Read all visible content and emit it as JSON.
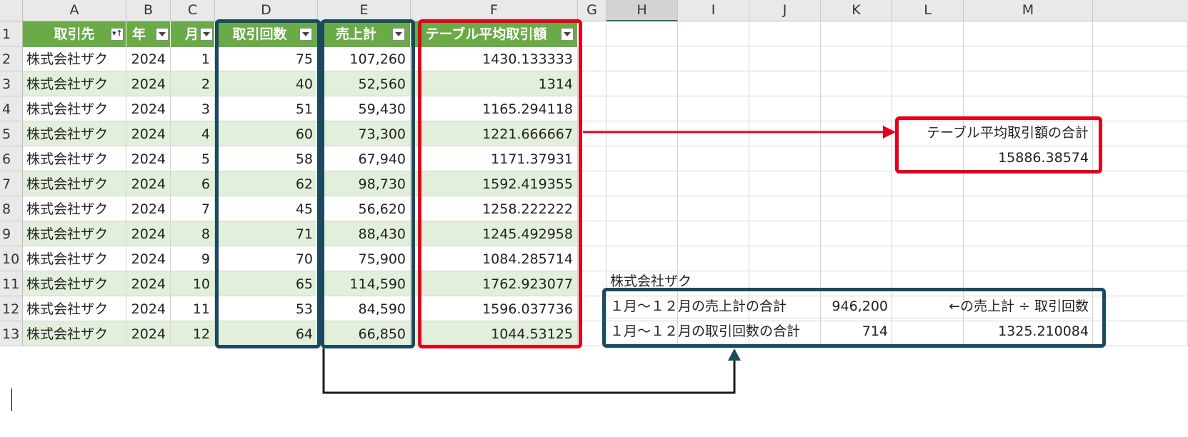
{
  "column_letters": [
    "A",
    "B",
    "C",
    "D",
    "E",
    "F",
    "G",
    "H",
    "I",
    "J",
    "K",
    "L",
    "M"
  ],
  "row_numbers": [
    "1",
    "2",
    "3",
    "4",
    "5",
    "6",
    "7",
    "8",
    "9",
    "10",
    "11",
    "12",
    "13"
  ],
  "table": {
    "headers": [
      "取引先",
      "年",
      "月",
      "取引回数",
      "売上計",
      "テーブル平均取引額"
    ],
    "rows": [
      [
        "株式会社ザク",
        "2024",
        "1",
        "75",
        "107,260",
        "1430.133333"
      ],
      [
        "株式会社ザク",
        "2024",
        "2",
        "40",
        "52,560",
        "1314"
      ],
      [
        "株式会社ザク",
        "2024",
        "3",
        "51",
        "59,430",
        "1165.294118"
      ],
      [
        "株式会社ザク",
        "2024",
        "4",
        "60",
        "73,300",
        "1221.666667"
      ],
      [
        "株式会社ザク",
        "2024",
        "5",
        "58",
        "67,940",
        "1171.37931"
      ],
      [
        "株式会社ザク",
        "2024",
        "6",
        "62",
        "98,730",
        "1592.419355"
      ],
      [
        "株式会社ザク",
        "2024",
        "7",
        "45",
        "56,620",
        "1258.222222"
      ],
      [
        "株式会社ザク",
        "2024",
        "8",
        "71",
        "88,430",
        "1245.492958"
      ],
      [
        "株式会社ザク",
        "2024",
        "9",
        "70",
        "75,900",
        "1084.285714"
      ],
      [
        "株式会社ザク",
        "2024",
        "10",
        "65",
        "114,590",
        "1762.923077"
      ],
      [
        "株式会社ザク",
        "2024",
        "11",
        "53",
        "84,590",
        "1596.037736"
      ],
      [
        "株式会社ザク",
        "2024",
        "12",
        "64",
        "66,850",
        "1044.53125"
      ]
    ]
  },
  "summary_avg": {
    "label": "テーブル平均取引額の合計",
    "value": "15886.38574"
  },
  "summary_company": {
    "company": "株式会社ザク",
    "sales_label": "１月～１２月の売上計の合計",
    "sales_value": "946,200",
    "note": "←の売上計 ÷ 取引回数",
    "count_label": "１月～１２月の取引回数の合計",
    "count_value": "714",
    "ratio_value": "1325.210084"
  },
  "colors": {
    "table_header": "#6aaa47",
    "band": "#e2efda",
    "navy_annotation": "#1b4a5e",
    "red_annotation": "#e3001b"
  }
}
